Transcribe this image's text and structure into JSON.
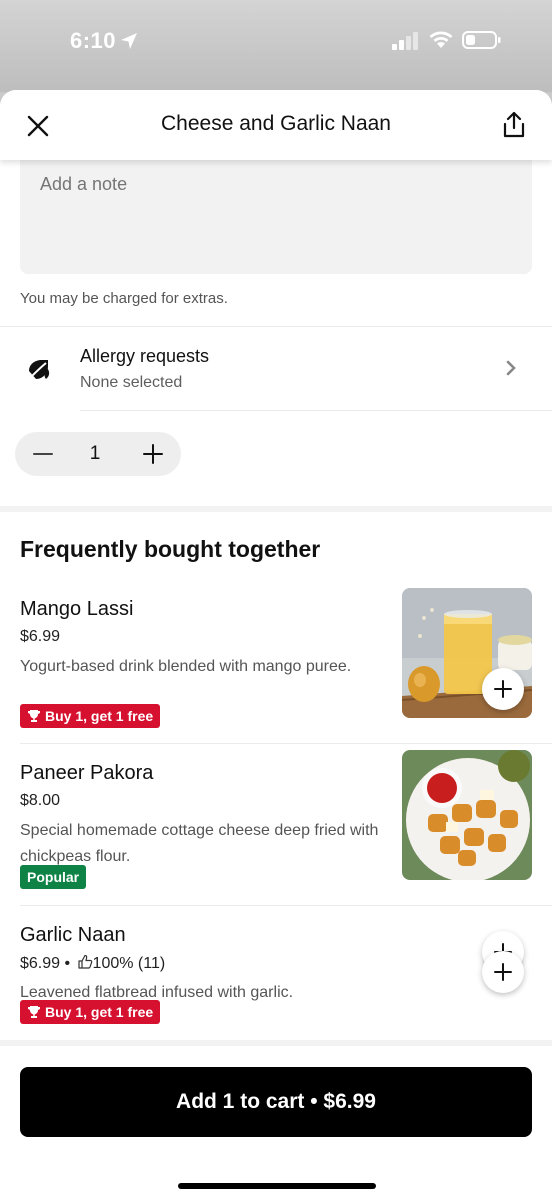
{
  "status_bar": {
    "time": "6:10"
  },
  "header": {
    "title": "Cheese and Garlic Naan"
  },
  "note": {
    "placeholder": "Add a note",
    "charge_text": "You may be charged for extras."
  },
  "allergy": {
    "title": "Allergy requests",
    "subtitle": "None selected"
  },
  "quantity": {
    "value": "1"
  },
  "frequently_bought": {
    "title": "Frequently bought together",
    "items": [
      {
        "name": "Mango Lassi",
        "price": "$6.99",
        "description": "Yogurt-based drink blended with mango puree.",
        "badge": "Buy 1, get 1 free"
      },
      {
        "name": "Paneer Pakora",
        "price": "$8.00",
        "description": "Special homemade cottage cheese deep fried with chickpeas flour.",
        "badge": "Popular"
      },
      {
        "name": "Garlic Naan",
        "price": "$6.99 •",
        "rating": "100% (11)",
        "description": "Leavened flatbread infused with garlic.",
        "badge": "Buy 1, get 1 free"
      }
    ]
  },
  "cart": {
    "label": "Add 1 to cart • $6.99"
  },
  "colors": {
    "promo_red": "#d6112f",
    "popular_green": "#0e8345",
    "cart_black": "#000000"
  }
}
